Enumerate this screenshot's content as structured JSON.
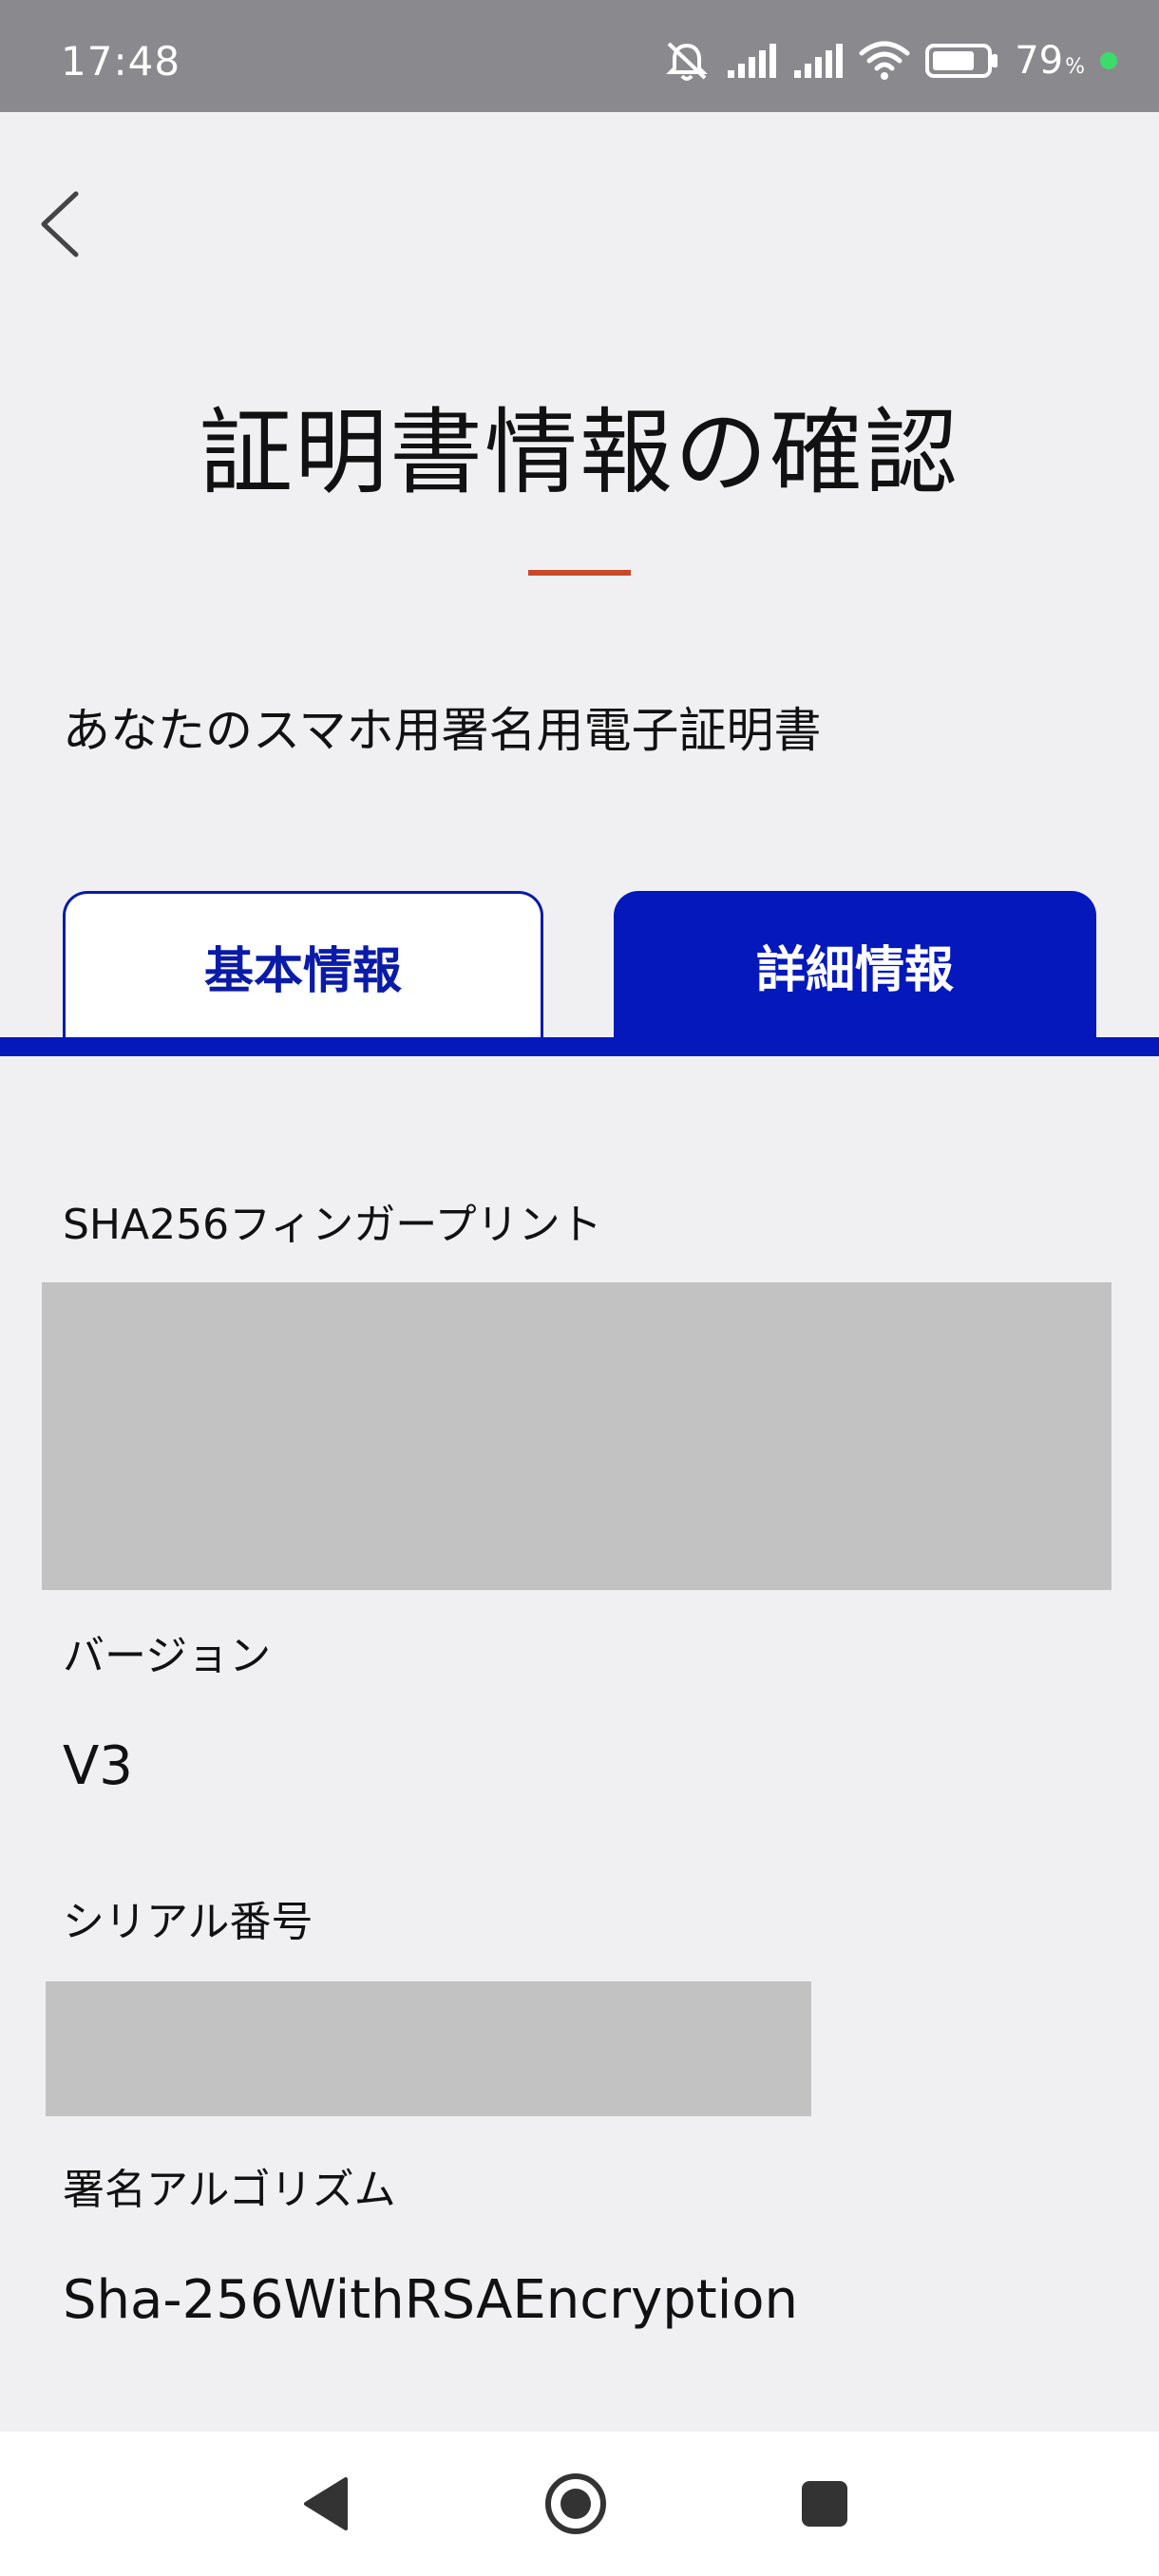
{
  "status_bar": {
    "time": "17:48",
    "battery_percent": "79",
    "battery_unit": "%",
    "battery_level": 0.79,
    "icons": [
      "mute-icon",
      "signal-icon",
      "signal-icon",
      "wifi-icon",
      "battery-icon"
    ],
    "indicator_color": "#3ddc6a"
  },
  "header": {
    "back_icon": "chevron-left-icon",
    "title": "証明書情報の確認",
    "accent_color": "#c8492a"
  },
  "certificate": {
    "name": "あなたのスマホ用署名用電子証明書"
  },
  "tabs": [
    {
      "label": "基本情報",
      "selected": false
    },
    {
      "label": "詳細情報",
      "selected": true
    }
  ],
  "brand_color": "#0418bc",
  "fields": {
    "fingerprint": {
      "label": "SHA256フィンガープリント",
      "value_redacted": true
    },
    "version": {
      "label": "バージョン",
      "value": "V3"
    },
    "serial": {
      "label": "シリアル番号",
      "value_redacted": true
    },
    "algorithm": {
      "label": "署名アルゴリズム",
      "value": "Sha-256WithRSAEncryption"
    }
  },
  "nav_bar": {
    "icons": [
      "back-triangle-icon",
      "home-circle-icon",
      "recents-square-icon"
    ]
  }
}
